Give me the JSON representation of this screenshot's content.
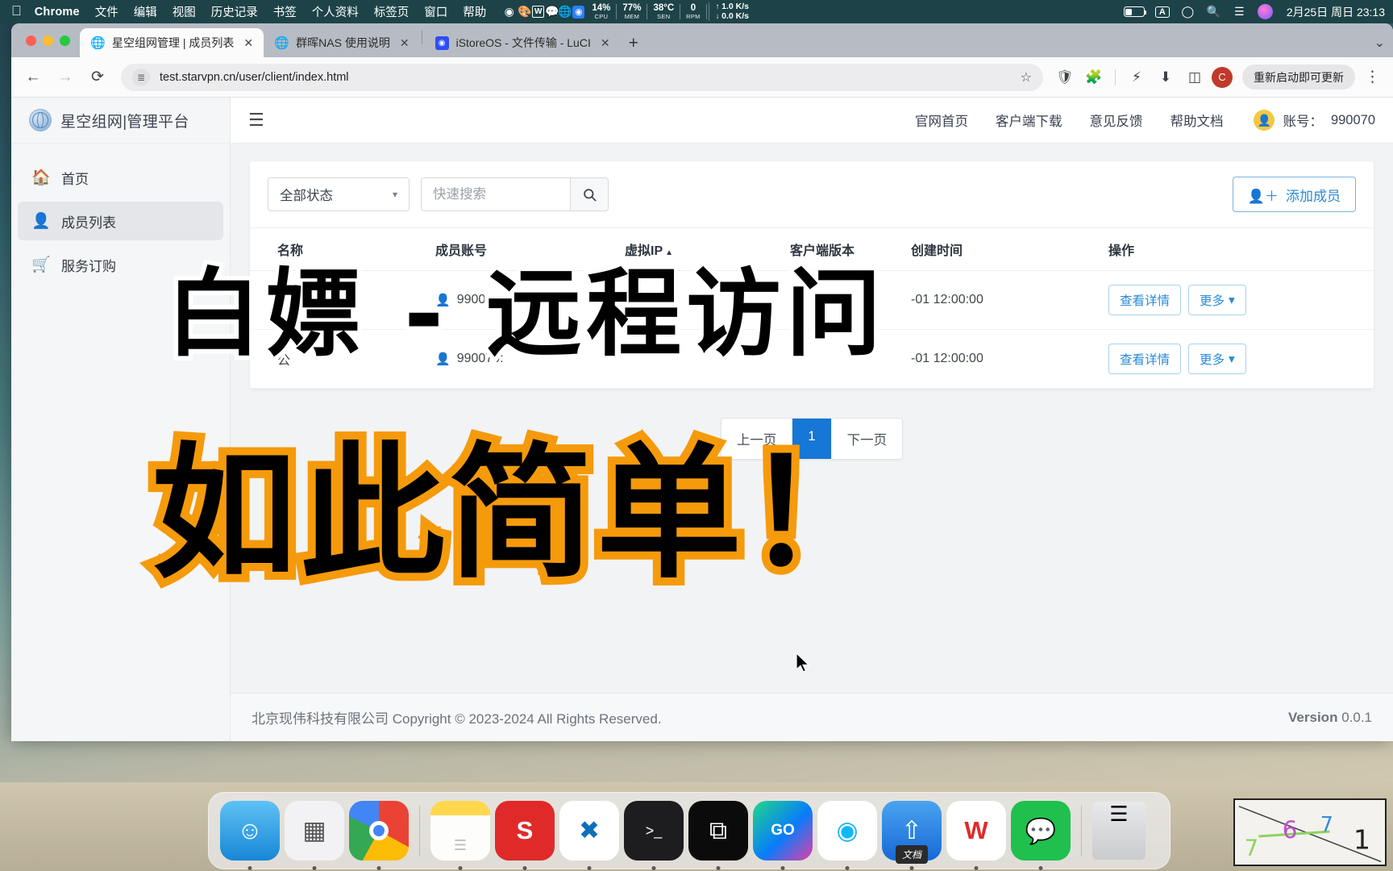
{
  "macos_menubar": {
    "apple_icon": "apple-logo-icon",
    "app_name": "Chrome",
    "menus": [
      "文件",
      "编辑",
      "视图",
      "历史记录",
      "书签",
      "个人资料",
      "标签页",
      "窗口",
      "帮助"
    ],
    "tray_icons": [
      "record-icon",
      "palette-icon",
      "wps-icon",
      "message-badge-icon",
      "globe-icon",
      "app-blue-icon"
    ],
    "message_badge": "1",
    "stats": [
      {
        "value": "14%",
        "label": "CPU"
      },
      {
        "value": "77%",
        "label": "MEM"
      },
      {
        "value": "38°C",
        "label": "SEN"
      },
      {
        "value": "0",
        "label": "RPM"
      }
    ],
    "network": {
      "up": "1.0 K/s",
      "down": "0.0 K/s"
    },
    "right_icons": [
      "battery-icon",
      "input-source-icon",
      "wifi-icon",
      "spotlight-search-icon",
      "control-center-icon",
      "siri-icon"
    ],
    "input_source": "A",
    "clock": "2月25日 周日  23:13"
  },
  "chrome": {
    "tabs": [
      {
        "title": "星空组网管理 | 成员列表",
        "favicon": "globe-icon",
        "active": true
      },
      {
        "title": "群晖NAS 使用说明",
        "favicon": "globe-icon",
        "active": false
      },
      {
        "title": "iStoreOS - 文件传输 - LuCI",
        "favicon": "istoreos-icon",
        "active": false
      }
    ],
    "new_tab_label": "+",
    "tabstrip_collapse": "⌄",
    "nav": {
      "back": "←",
      "forward": "→",
      "reload": "⟳"
    },
    "omnibox": {
      "site_settings_icon": "page-settings-icon",
      "url": "test.starvpn.cn/user/client/index.html",
      "star_icon": "bookmark-star-icon"
    },
    "toolbar_icons": [
      "shield-extension-icon",
      "puzzle-extension-icon",
      "performance-icon",
      "download-icon",
      "side-panel-icon"
    ],
    "profile_initial": "C",
    "update_button": "重新启动即可更新",
    "kebab": "⋮"
  },
  "app": {
    "brand": {
      "icon": "globe-logo-icon",
      "title": "星空组网|管理平台"
    },
    "sidebar": [
      {
        "label": "首页",
        "icon": "home-icon",
        "active": false
      },
      {
        "label": "成员列表",
        "icon": "user-icon",
        "active": true
      },
      {
        "label": "服务订购",
        "icon": "cart-icon",
        "active": false
      }
    ],
    "topbar": {
      "hamburger": "☰",
      "nav": [
        "官网首页",
        "客户端下载",
        "意见反馈",
        "帮助文档"
      ],
      "account_label": "账号：",
      "account_value": "990070",
      "account_avatar": "user-avatar-icon"
    },
    "filters": {
      "status_select_value": "全部状态",
      "search_placeholder": "快速搜索",
      "search_value": "",
      "search_icon": "search-icon",
      "add_member_label": "添加成员",
      "add_member_icon": "add-user-icon"
    },
    "table": {
      "columns": [
        "名称",
        "成员账号",
        "虚拟IP",
        "客户端版本",
        "创建时间",
        "操作"
      ],
      "sorted_column": "虚拟IP",
      "sort_direction": "asc",
      "rows": [
        {
          "name": "",
          "account": "990070:1",
          "virtual_ip": "",
          "client_version": "",
          "created_at": "-01 12:00:00",
          "actions": [
            "查看详情",
            "更多"
          ]
        },
        {
          "name": "公",
          "account": "990070:",
          "virtual_ip": "",
          "client_version": "",
          "created_at": "-01 12:00:00",
          "actions": [
            "查看详情",
            "更多"
          ]
        }
      ]
    },
    "pagination": {
      "prev": "上一页",
      "current": "1",
      "next": "下一页"
    },
    "footer": {
      "copyright": "北京现伟科技有限公司 Copyright © 2023-2024 All Rights Reserved.",
      "version_label": "Version",
      "version_value": "0.0.1"
    }
  },
  "overlay_captions": {
    "line1": "白嫖 - 远程访问",
    "line2": "如此简单！"
  },
  "dock": {
    "apps": [
      {
        "name": "finder-icon",
        "glyph": "☺",
        "bg": "linear-gradient(180deg,#5ec2f5,#1886d6)",
        "running": true
      },
      {
        "name": "launchpad-icon",
        "glyph": "▦",
        "bg": "#f2f2f4",
        "running": false
      },
      {
        "name": "chrome-icon",
        "glyph": "◉",
        "bg": "conic-gradient(#ea4335 0 33%, #fbbc05 33% 58%, #34a853 58% 82%, #4285f4 82% 100%)",
        "running": true
      },
      {
        "name": "notes-icon",
        "glyph": "▤",
        "bg": "linear-gradient(180deg,#ffd84d 0 22%,#fdfdfb 22%)",
        "running": true
      },
      {
        "name": "sublime-icon",
        "glyph": "S",
        "bg": "#e02a2a",
        "running": true
      },
      {
        "name": "vscode-icon",
        "glyph": "✖",
        "bg": "#ffffff",
        "running": true
      },
      {
        "name": "terminal-icon",
        "glyph": ">_",
        "bg": "#1d1d1f",
        "running": true
      },
      {
        "name": "hourglass-icon",
        "glyph": "⧗",
        "bg": "#0b0b0b",
        "running": true
      },
      {
        "name": "goland-icon",
        "glyph": "GO",
        "bg": "linear-gradient(135deg,#21d789,#087cfa,#e23ea8)",
        "running": true
      },
      {
        "name": "qq-icon",
        "glyph": "◔",
        "bg": "#ffffff",
        "running": true
      },
      {
        "name": "documents-icon",
        "glyph": "⇪",
        "bg": "linear-gradient(180deg,#4aa3f0,#1769d6)",
        "running": true,
        "tooltip": "文档"
      },
      {
        "name": "wps-icon",
        "glyph": "W",
        "bg": "#ffffff",
        "running": true
      },
      {
        "name": "wechat-icon",
        "glyph": "💬",
        "bg": "#1fc04d",
        "running": true
      }
    ],
    "trash": {
      "name": "trash-icon",
      "glyph": "🗑"
    }
  }
}
